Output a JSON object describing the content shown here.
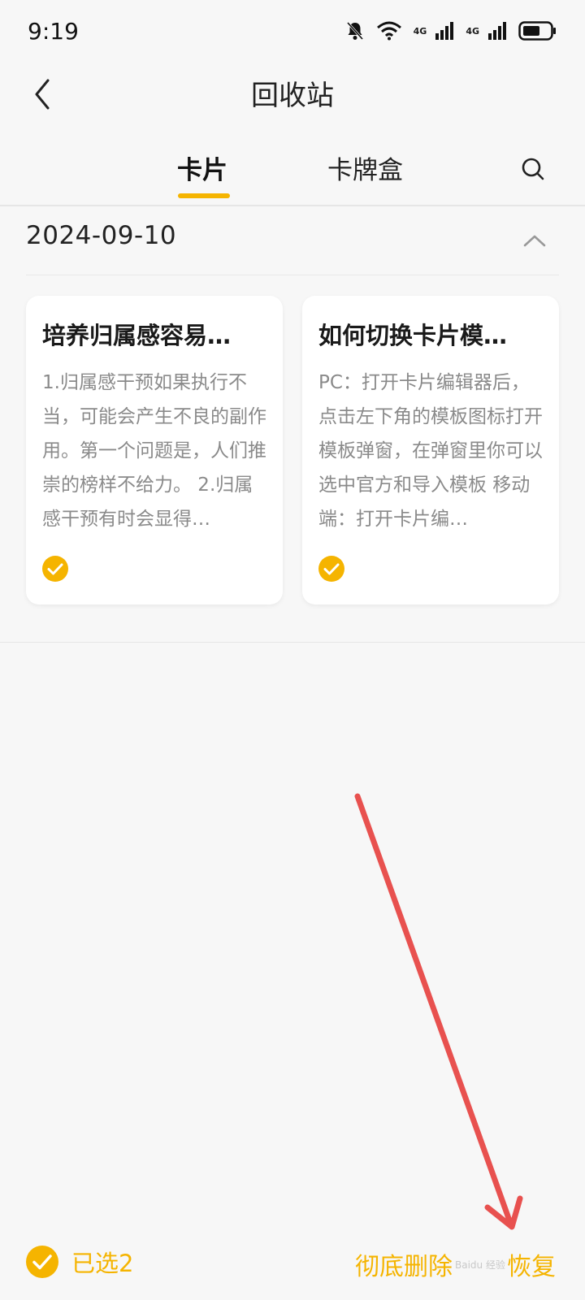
{
  "status_bar": {
    "time": "9:19",
    "network_1": "4G",
    "network_2": "4G",
    "icons": [
      "bell-off-icon",
      "wifi-icon",
      "signal-icon",
      "signal-icon",
      "battery-icon"
    ]
  },
  "header": {
    "title": "回收站",
    "back_icon": "chevron-left-icon"
  },
  "tabs": [
    {
      "label": "卡片",
      "active": true
    },
    {
      "label": "卡牌盒",
      "active": false
    }
  ],
  "search_icon": "search-icon",
  "date_group": {
    "date": "2024-09-10",
    "toggle_icon": "chevron-up-icon"
  },
  "cards": [
    {
      "title": "培养归属感容易…",
      "body": "1.归属感干预如果执行不当，可能会产生不良的副作用。第一个问题是，人们推崇的榜样不给力。 2.归属感干预有时会显得…",
      "selected": true
    },
    {
      "title": "如何切换卡片模…",
      "body": "PC：打开卡片编辑器后，点击左下角的模板图标打开模板弹窗，在弹窗里你可以选中官方和导入模板 移动端：打开卡片编…",
      "selected": true
    }
  ],
  "bottom_bar": {
    "selected_label": "已选2",
    "delete_label": "彻底删除",
    "restore_label": "恢复"
  },
  "colors": {
    "accent": "#f5b400",
    "annotation": "#e8514f"
  },
  "watermark": "Baidu 经验"
}
